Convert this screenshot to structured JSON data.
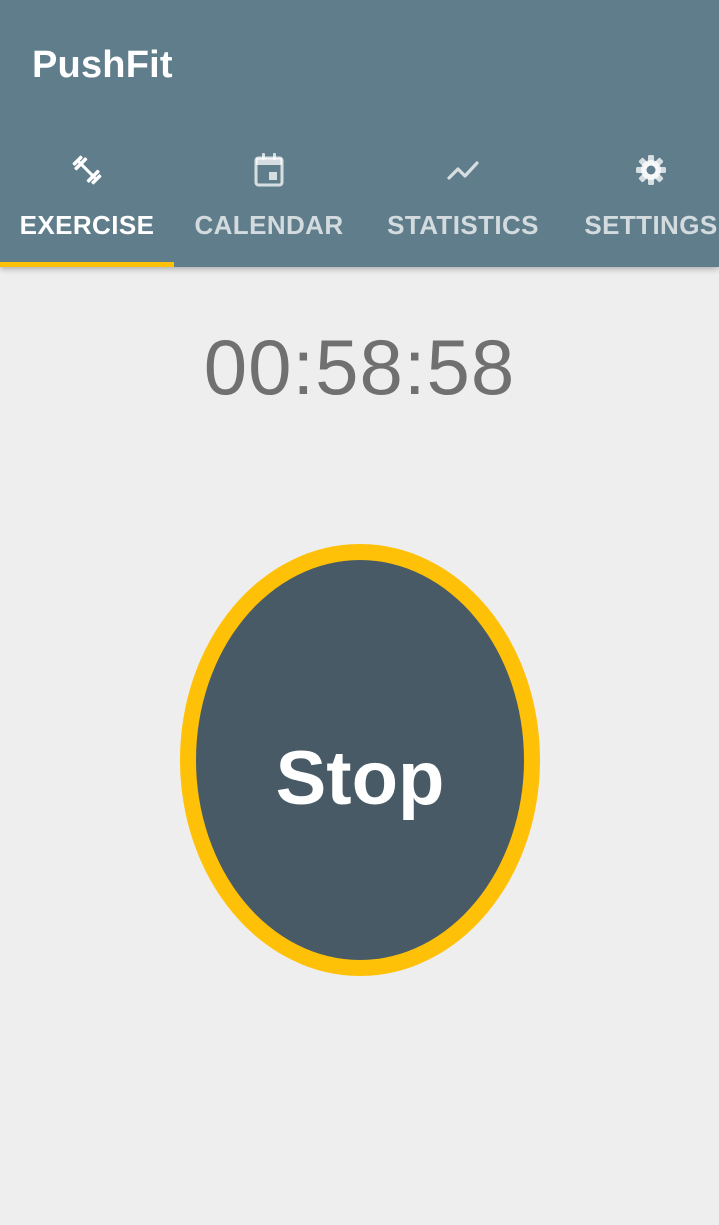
{
  "app": {
    "title": "PushFit"
  },
  "tabs": [
    {
      "label": "EXERCISE",
      "icon": "dumbbell-icon",
      "active": true
    },
    {
      "label": "CALENDAR",
      "icon": "calendar-icon",
      "active": false
    },
    {
      "label": "STATISTICS",
      "icon": "trending-line-icon",
      "active": false
    },
    {
      "label": "SETTINGS",
      "icon": "gear-icon",
      "active": false
    }
  ],
  "timer": {
    "value": "00:58:58"
  },
  "stop_button": {
    "label": "Stop"
  },
  "colors": {
    "app_bar": "#607d8b",
    "accent": "#ffc107",
    "button_fill": "#475a66",
    "background": "#eeeeee",
    "timer_text": "#707070"
  }
}
